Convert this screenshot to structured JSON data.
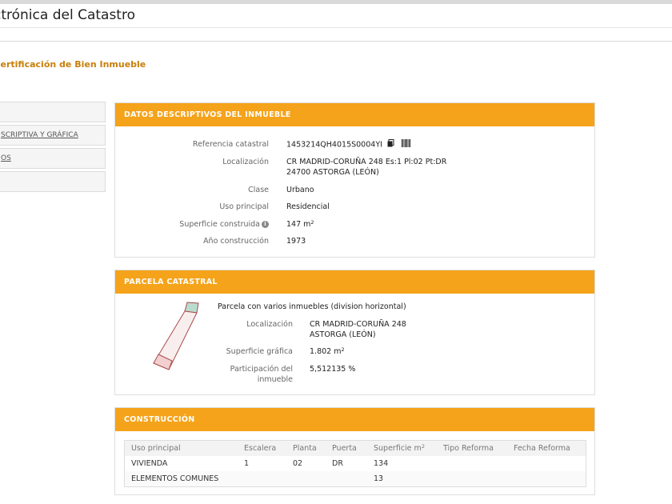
{
  "header": {
    "site_title": "ctrónica del Catastro",
    "subtitle": "certificación de Bien Inmueble"
  },
  "sidebar": {
    "items": [
      {
        "label": ""
      },
      {
        "label": "SCRIPTIVA Y GRÁFICA"
      },
      {
        "label": "OS"
      },
      {
        "label": ""
      }
    ]
  },
  "datos": {
    "title": "DATOS DESCRIPTIVOS DEL INMUEBLE",
    "ref_label": "Referencia catastral",
    "ref_value": "1453214QH4015S0004YI",
    "loc_label": "Localización",
    "loc_line1": "CR MADRID-CORUÑA 248 Es:1 Pl:02 Pt:DR",
    "loc_line2": "24700 ASTORGA (LEÓN)",
    "clase_label": "Clase",
    "clase_value": "Urbano",
    "uso_label": "Uso principal",
    "uso_value": "Residencial",
    "sup_label": "Superficie construida",
    "sup_value": "147 m",
    "sup_unit_exp": "2",
    "anio_label": "Año construcción",
    "anio_value": "1973",
    "icon_info": "info-icon",
    "icon_copy": "copy-icon",
    "icon_barcode": "barcode-icon"
  },
  "parcela": {
    "title": "PARCELA CATASTRAL",
    "description": "Parcela con varios inmuebles (division horizontal)",
    "loc_label": "Localización",
    "loc_line1": "CR MADRID-CORUÑA 248",
    "loc_line2": "ASTORGA (LEÓN)",
    "sup_label": "Superficie gráfica",
    "sup_value": "1.802 m",
    "sup_unit_exp": "2",
    "part_label_1": "Participación del",
    "part_label_2": "inmueble",
    "part_value": "5,512135 %"
  },
  "construccion": {
    "title": "CONSTRUCCIÓN",
    "headers": {
      "uso": "Uso principal",
      "escalera": "Escalera",
      "planta": "Planta",
      "puerta": "Puerta",
      "superficie": "Superficie m",
      "superficie_exp": "2",
      "tipo": "Tipo Reforma",
      "fecha": "Fecha Reforma"
    },
    "rows": [
      {
        "uso": "VIVIENDA",
        "escalera": "1",
        "planta": "02",
        "puerta": "DR",
        "superficie": "134",
        "tipo": "",
        "fecha": ""
      },
      {
        "uso": "ELEMENTOS COMUNES",
        "escalera": "",
        "planta": "",
        "puerta": "",
        "superficie": "13",
        "tipo": "",
        "fecha": ""
      }
    ]
  },
  "colors": {
    "accent_orange": "#f5a31a",
    "subtitle_orange": "#c87f0a",
    "parcel_fill": "#f8eeee",
    "parcel_stroke": "#a94b4b",
    "parcel_top": "#b9dccf"
  }
}
